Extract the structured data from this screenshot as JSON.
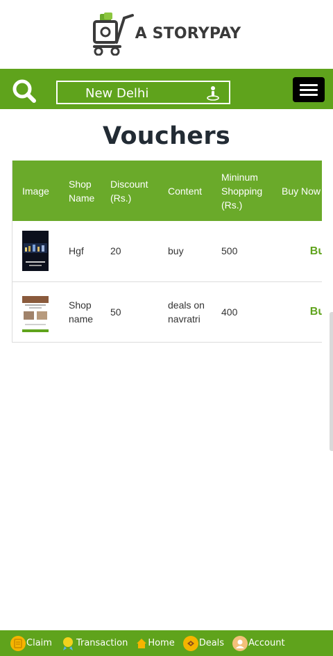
{
  "brand": {
    "name": "A STORYPAY"
  },
  "search": {
    "location": "New Delhi"
  },
  "page": {
    "title": "Vouchers"
  },
  "table": {
    "headers": {
      "image": "Image",
      "shop_name": "Shop Name",
      "discount": "Discount (Rs.)",
      "content": "Content",
      "min_shopping": "Mininum Shopping (Rs.)",
      "buy_now": "Buy Now"
    },
    "rows": [
      {
        "shop": "Hgf",
        "discount": "20",
        "content": "buy",
        "min_shopping": "500",
        "buy": "Buy"
      },
      {
        "shop": "Shop name",
        "discount": "50",
        "content": "deals on navratri",
        "min_shopping": "400",
        "buy": "Buy"
      }
    ]
  },
  "nav": {
    "claim": "Claim",
    "transaction": "Transaction",
    "home": "Home",
    "deals": "Deals",
    "account": "Account"
  },
  "colors": {
    "brand_green": "#5fa31c",
    "header_green": "#6aaa2a",
    "title_dark": "#222b34"
  }
}
